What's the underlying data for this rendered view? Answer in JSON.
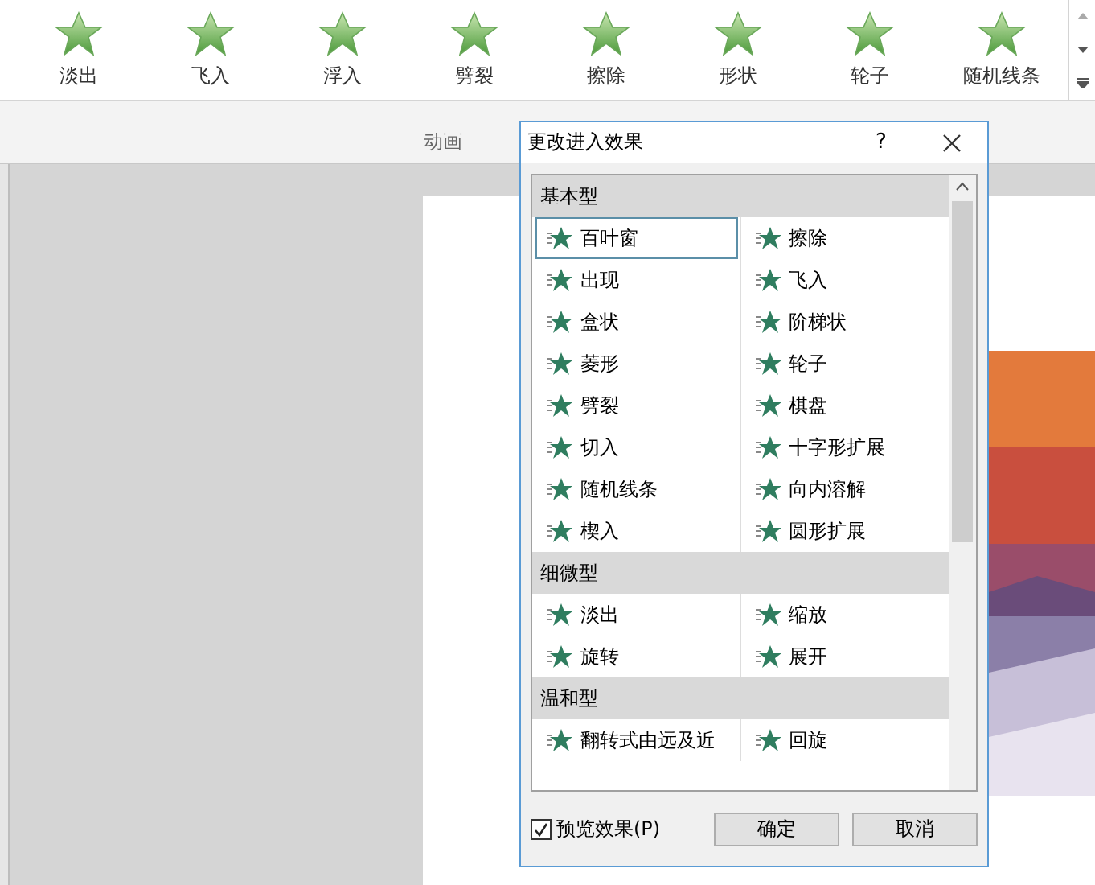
{
  "ribbon": {
    "effects": [
      {
        "label": "淡出"
      },
      {
        "label": "飞入"
      },
      {
        "label": "浮入"
      },
      {
        "label": "劈裂"
      },
      {
        "label": "擦除"
      },
      {
        "label": "形状"
      },
      {
        "label": "轮子"
      },
      {
        "label": "随机线条"
      }
    ],
    "group_label": "动画"
  },
  "dialog": {
    "title": "更改进入效果",
    "help": "?",
    "groups": [
      {
        "title": "基本型",
        "items": [
          {
            "label": "百叶窗",
            "selected": true
          },
          {
            "label": "擦除",
            "selected": false
          },
          {
            "label": "出现",
            "selected": false
          },
          {
            "label": "飞入",
            "selected": false
          },
          {
            "label": "盒状",
            "selected": false
          },
          {
            "label": "阶梯状",
            "selected": false
          },
          {
            "label": "菱形",
            "selected": false
          },
          {
            "label": "轮子",
            "selected": false
          },
          {
            "label": "劈裂",
            "selected": false
          },
          {
            "label": "棋盘",
            "selected": false
          },
          {
            "label": "切入",
            "selected": false
          },
          {
            "label": "十字形扩展",
            "selected": false
          },
          {
            "label": "随机线条",
            "selected": false
          },
          {
            "label": "向内溶解",
            "selected": false
          },
          {
            "label": "楔入",
            "selected": false
          },
          {
            "label": "圆形扩展",
            "selected": false
          }
        ]
      },
      {
        "title": "细微型",
        "items": [
          {
            "label": "淡出",
            "selected": false
          },
          {
            "label": "缩放",
            "selected": false
          },
          {
            "label": "旋转",
            "selected": false
          },
          {
            "label": "展开",
            "selected": false
          }
        ]
      },
      {
        "title": "温和型",
        "items": [
          {
            "label": "翻转式由远及近",
            "selected": false
          },
          {
            "label": "回旋",
            "selected": false
          }
        ]
      }
    ],
    "preview": {
      "label": "预览效果(P)",
      "checked": true
    },
    "buttons": [
      "确定",
      "取消"
    ]
  }
}
